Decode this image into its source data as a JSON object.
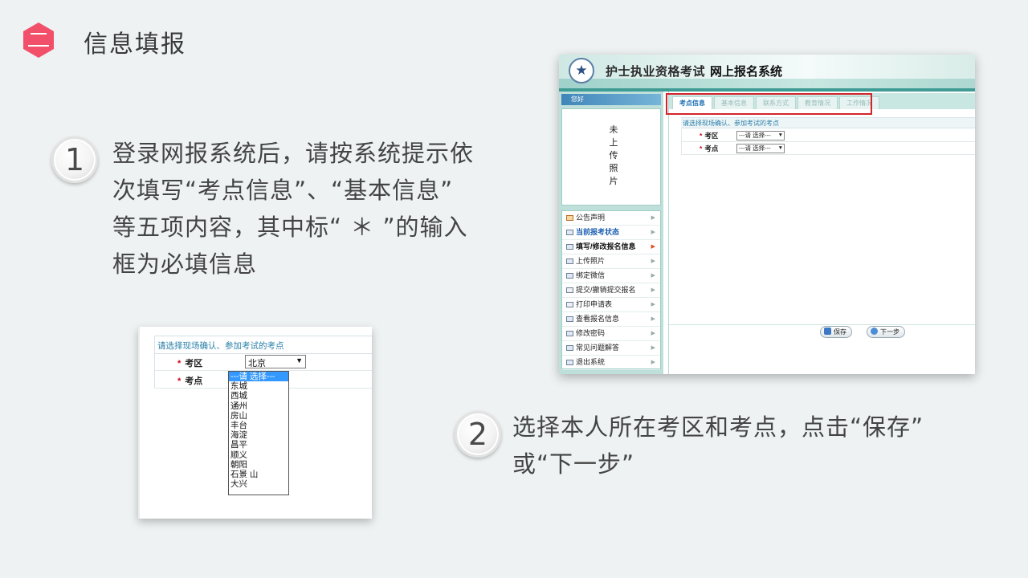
{
  "slide": {
    "section_number": "二",
    "title": "信息填报",
    "colors": {
      "accent": "#f2506a",
      "background": "#eef2f2"
    }
  },
  "steps": [
    {
      "number": "1",
      "lines": [
        "登录网报系统后，请按系统提示依",
        "次填写“考点信息”、“基本信息”",
        "等五项内容，其中标“ ＊ ”的输入",
        "框为必填信息"
      ]
    },
    {
      "number": "2",
      "lines": [
        "选择本人所在考区和考点，点击“保存”",
        "或“下一步”"
      ]
    }
  ],
  "mini_screenshot": {
    "hint": "请选择现场确认、参加考试的考点",
    "fields": [
      {
        "label": "考区",
        "value": "北京"
      },
      {
        "label": "考点",
        "value": ""
      }
    ],
    "dropdown_options": [
      "---请 选择---",
      "东城",
      "西城",
      "通州",
      "房山",
      "丰台",
      "海淀",
      "昌平",
      "顺义",
      "朝阳",
      "石景 山",
      "大兴"
    ],
    "selected_index": 0
  },
  "big_screenshot": {
    "system_title_part1": "护士执业资格考试",
    "system_title_part2": "网上报名系统",
    "welcome": "您好",
    "photo_placeholder": [
      "未",
      "上",
      "传",
      "照",
      "片"
    ],
    "tabs": [
      "考点信息",
      "基本信息",
      "联系方式",
      "教育情况",
      "工作情况"
    ],
    "active_tab": 0,
    "hint": "请选择现场确认、参加考试的考点",
    "fields": [
      {
        "label": "考区",
        "value": "---请 选择---"
      },
      {
        "label": "考点",
        "value": "---请 选择---"
      }
    ],
    "menu": [
      {
        "label": "公告声明",
        "style": "normal",
        "icon": "house-icon"
      },
      {
        "label": "当前报考状态",
        "style": "blue",
        "icon": "card-icon"
      },
      {
        "label": "填写/修改报名信息",
        "style": "bold",
        "icon": "card-icon"
      },
      {
        "label": "上传照片",
        "style": "normal",
        "icon": "card-icon"
      },
      {
        "label": "绑定微信",
        "style": "normal",
        "icon": "card-icon"
      },
      {
        "label": "提交/撤销提交报名",
        "style": "normal",
        "icon": "doc-icon"
      },
      {
        "label": "打印申请表",
        "style": "normal",
        "icon": "doc-icon"
      },
      {
        "label": "查看报名信息",
        "style": "normal",
        "icon": "card-icon"
      },
      {
        "label": "修改密码",
        "style": "normal",
        "icon": "card-icon"
      },
      {
        "label": "常见问题解答",
        "style": "normal",
        "icon": "card-icon"
      },
      {
        "label": "退出系统",
        "style": "normal",
        "icon": "card-icon"
      }
    ],
    "buttons": {
      "save": "保存",
      "next": "下一步"
    }
  }
}
